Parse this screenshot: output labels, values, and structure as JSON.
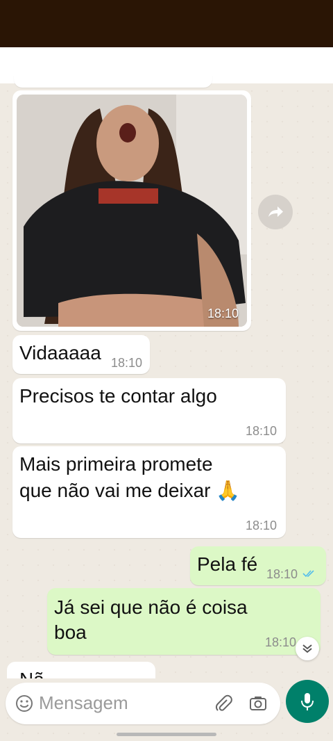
{
  "chat": {
    "photo_time": "18:10",
    "messages": [
      {
        "text": "Vidaaaaa",
        "time": "18:10"
      },
      {
        "text": "Precisos te contar algo",
        "time": "18:10"
      },
      {
        "line1": "Mais primeira promete",
        "line2": "que não vai me deixar 🙏",
        "time": "18:10"
      },
      {
        "text": "Pela fé",
        "time": "18:10"
      },
      {
        "line1": "Já sei que não é coisa",
        "line2": "boa",
        "time": "18:10"
      },
      {
        "text": "Nã..."
      }
    ]
  },
  "input": {
    "placeholder": "Mensagem"
  },
  "colors": {
    "accent": "#00806a",
    "outgoing": "#dcf8c6",
    "read_ticks": "#53bdeb"
  }
}
